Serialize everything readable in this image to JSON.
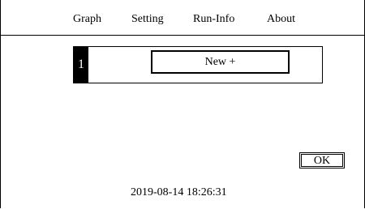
{
  "menu": {
    "items": [
      {
        "label": "Graph"
      },
      {
        "label": "Setting"
      },
      {
        "label": "Run-Info"
      },
      {
        "label": "About"
      }
    ]
  },
  "entry": {
    "index": "1",
    "new_label": "New +"
  },
  "ok_label": "OK",
  "status": {
    "datetime": "2019-08-14 18:26:31"
  }
}
